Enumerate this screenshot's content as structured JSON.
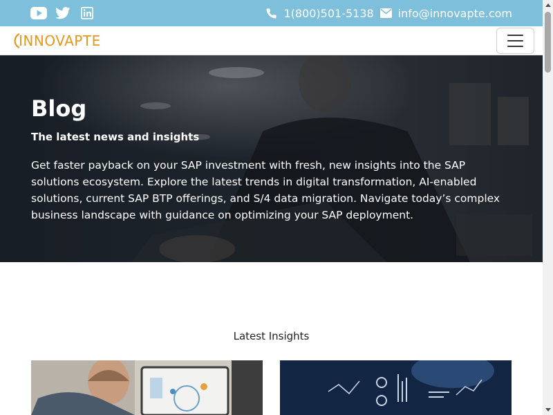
{
  "topbar": {
    "social": [
      {
        "icon": "youtube-icon"
      },
      {
        "icon": "twitter-icon"
      },
      {
        "icon": "linkedin-icon"
      }
    ],
    "phone": "1(800)501-5138",
    "email": "info@innovapte.com"
  },
  "navbar": {
    "logo_text": "INNOVAPTE",
    "menu_icon": "hamburger-menu-icon"
  },
  "hero": {
    "title": "Blog",
    "subtitle": "The latest news and insights",
    "description": "Get faster payback on your SAP investment with fresh, new insights into the SAP solutions ecosystem. Explore the latest trends in digital transformation, AI-enabled solutions, current SAP BTP offerings, and S/4 data migration. Navigate today’s complex business landscape with guidance on optimizing your SAP deployment."
  },
  "insights": {
    "title": "Latest Insights"
  },
  "colors": {
    "topbar": "#7ec0dc",
    "brand_orange": "#e8961e",
    "hero_dark": "#1c232b"
  }
}
